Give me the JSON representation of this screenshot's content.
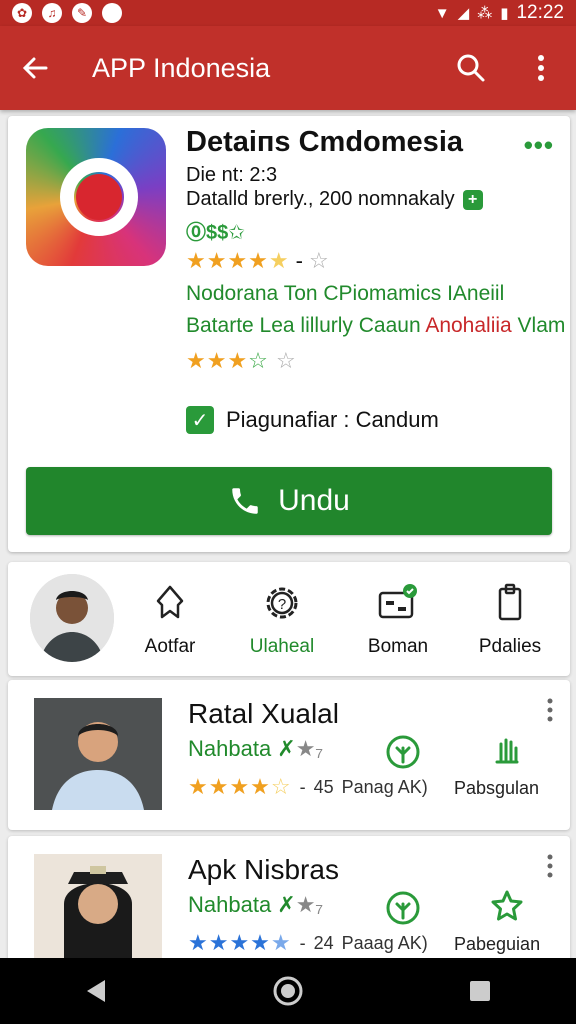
{
  "status_bar": {
    "time": "12:22",
    "left_icons": [
      "app-icon-1",
      "app-icon-2",
      "app-icon-3",
      "app-icon-4"
    ]
  },
  "app_bar": {
    "title": "APP Indonesia",
    "icons": [
      "back-arrow-icon",
      "search-icon",
      "more-vert-icon"
    ]
  },
  "app_detail": {
    "title": "Detaiпs Cmdomesia",
    "line1": "Die nt: 2:3",
    "line2": "Datalld brerly., 200 nomnakaly",
    "code_tag": "⓪$$✩",
    "green_line1": "Nodorana Ton CPiomamics IAneiil",
    "green_line2_prefix": "Batarte Lea lillurly Caaun ",
    "green_line2_red": "Anohaliia",
    "green_line2_suffix": " Vlam",
    "rating_top": 4.5,
    "rating_second": 3.5,
    "check_label": "Piagunafiar : Candum",
    "install_label": "Undu"
  },
  "actions": [
    {
      "label": "Aotfar",
      "icon": "bookmark-outline-icon",
      "active": false
    },
    {
      "label": "Ulaheal",
      "icon": "gear-question-icon",
      "active": true
    },
    {
      "label": "Boman",
      "icon": "media-badge-icon",
      "active": false
    },
    {
      "label": "Pdalies",
      "icon": "clipboard-icon",
      "active": false
    }
  ],
  "list_items": [
    {
      "title": "Ratal Xualal",
      "subtitle": "Nahbata ✗",
      "subtitle_gray": "★₇",
      "rating": 4.5,
      "count": "45",
      "meta": "Panag AK)",
      "cat_label": "Pabsgulan",
      "star_color": "#f0a020"
    },
    {
      "title": "Apk Nisbras",
      "subtitle": "Nahbata ✗",
      "subtitle_gray": "★₇",
      "rating": 4.5,
      "count": "24",
      "meta": "Paaag AK)",
      "cat_label": "Pabeguian",
      "star_color": "#2b73d8"
    }
  ],
  "colors": {
    "primary": "#c0302a",
    "accent_green": "#21862c",
    "star": "#f0a020"
  }
}
